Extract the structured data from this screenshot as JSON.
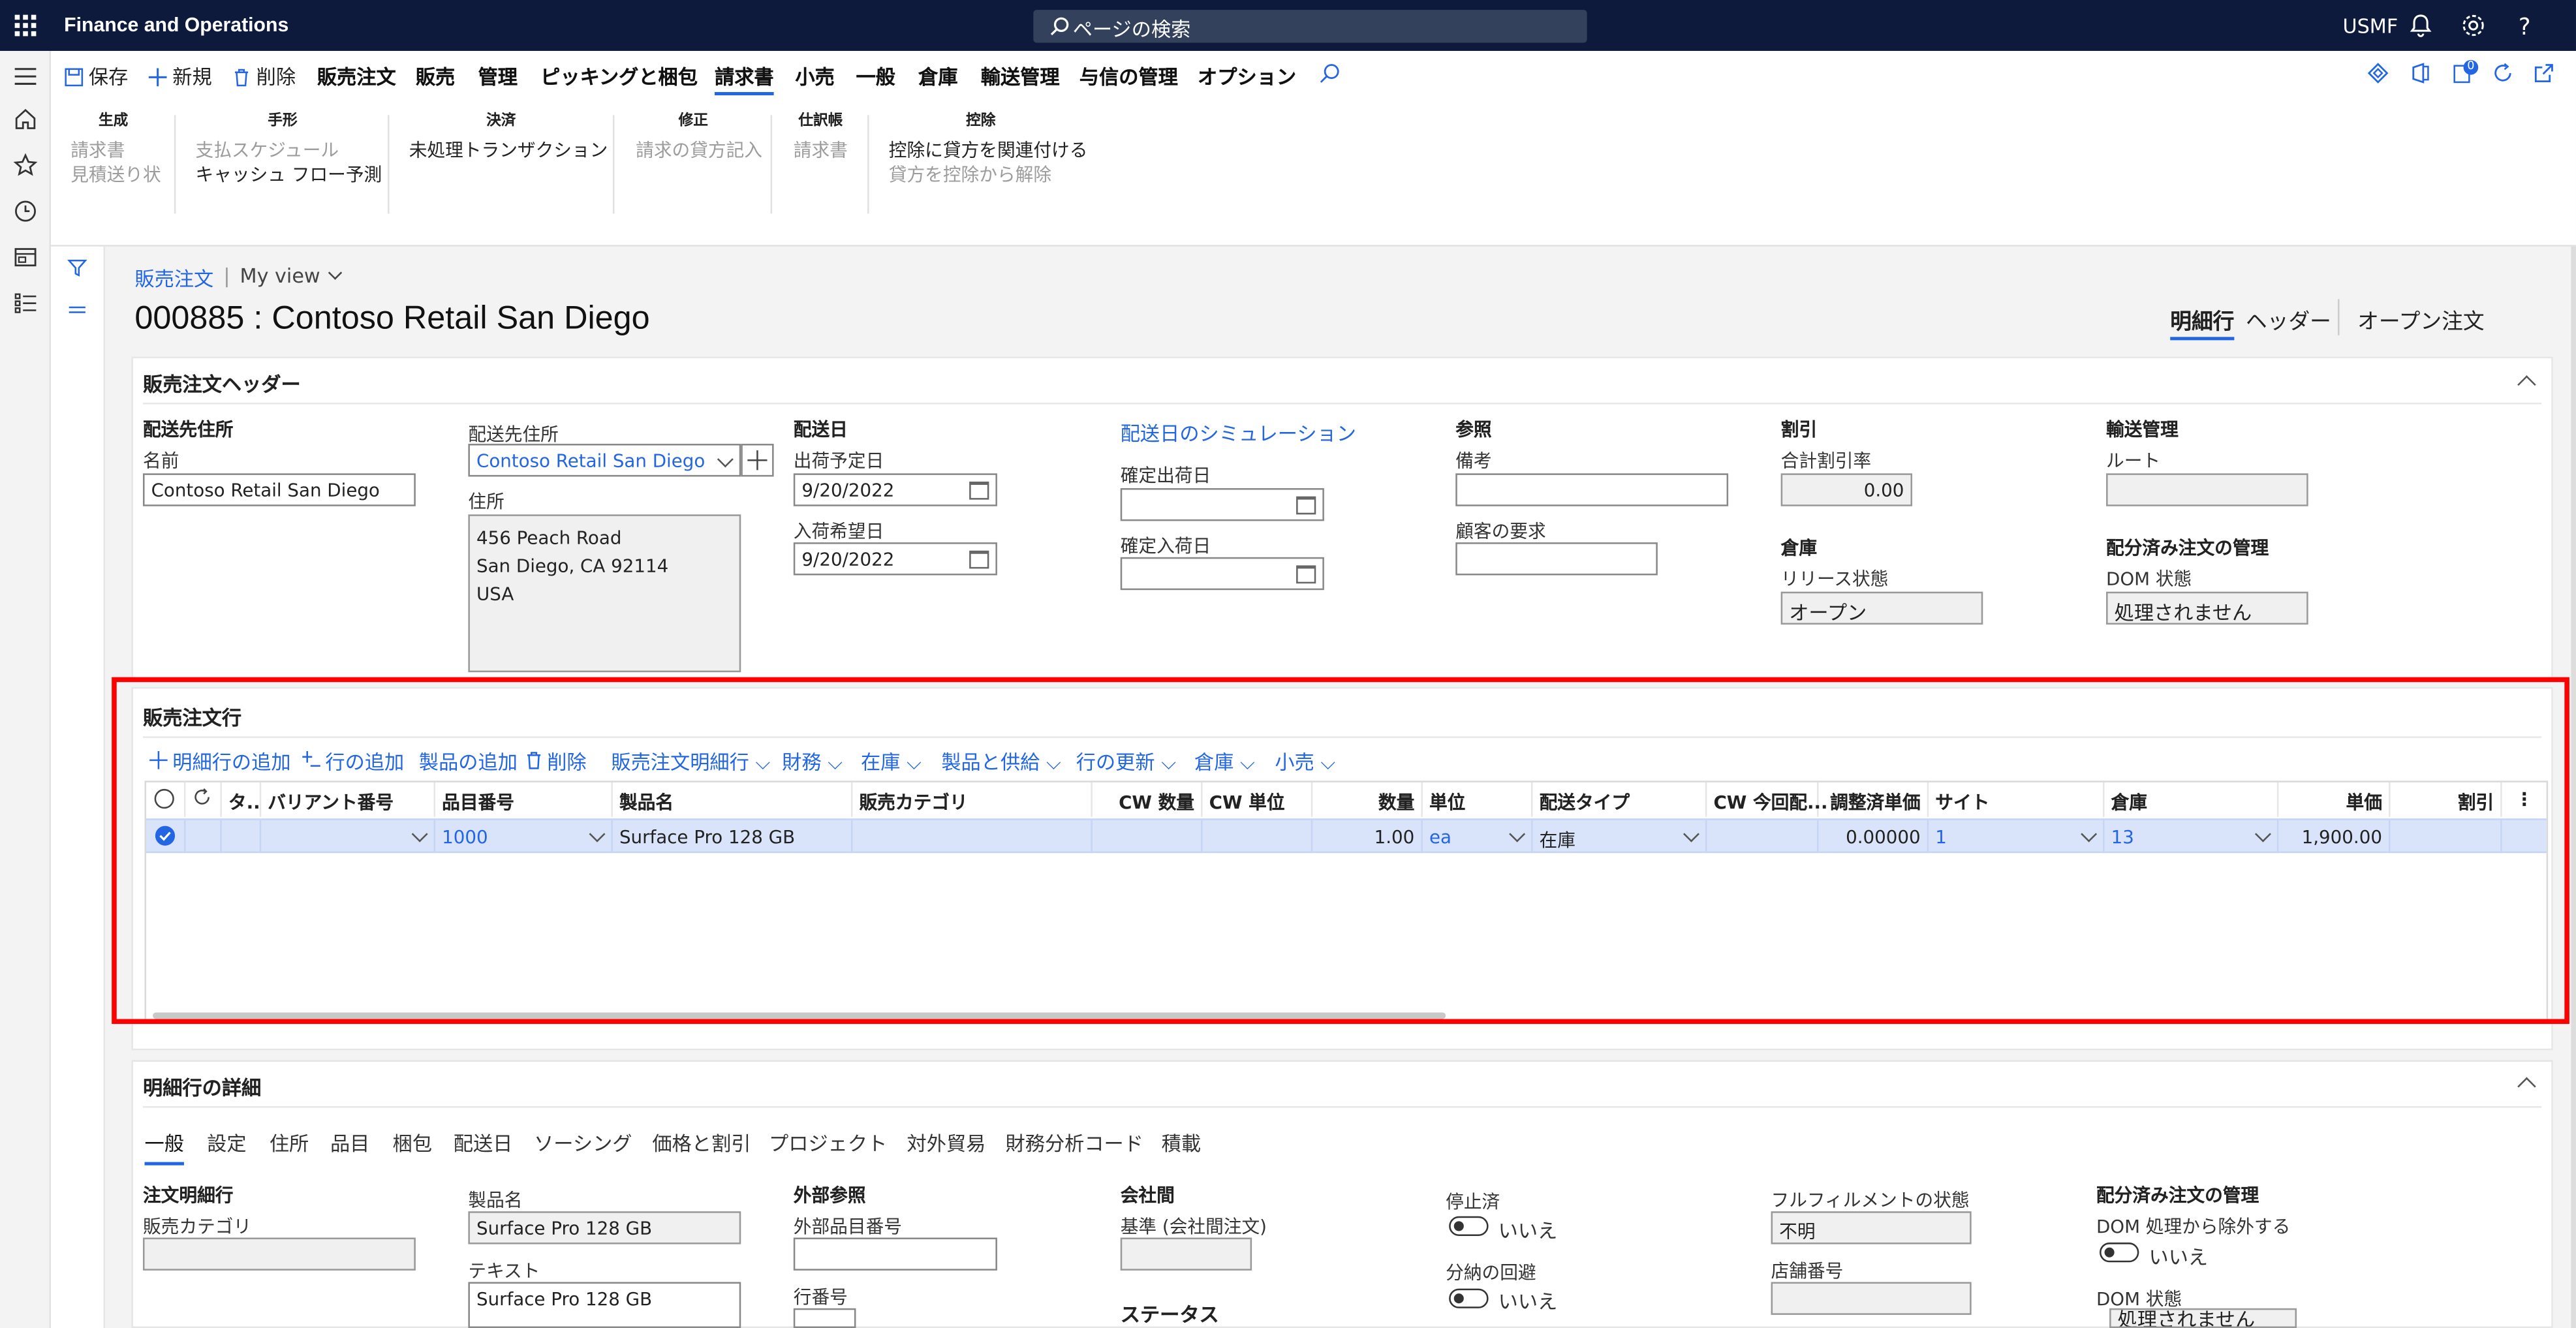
{
  "app_title": "Finance and Operations",
  "search": {
    "placeholder": "ページの検索"
  },
  "company": "USMF",
  "notification_count": "0",
  "action_pane": {
    "buttons": {
      "save": "保存",
      "new": "新規",
      "delete": "削除"
    },
    "tabs": [
      "販売注文",
      "販売",
      "管理",
      "ピッキングと梱包",
      "請求書",
      "小売",
      "一般",
      "倉庫",
      "輸送管理",
      "与信の管理",
      "オプション"
    ],
    "active_tab": "請求書",
    "groups": {
      "generate": {
        "title": "生成",
        "items": [
          "請求書",
          "見積送り状"
        ]
      },
      "draft": {
        "title": "手形",
        "items": [
          "支払スケジュール",
          "キャッシュ フロー予測"
        ]
      },
      "settle": {
        "title": "決済",
        "items": [
          "未処理トランザクション"
        ]
      },
      "correct": {
        "title": "修正",
        "items": [
          "請求の貸方記入"
        ]
      },
      "journal": {
        "title": "仕訳帳",
        "items": [
          "請求書"
        ]
      },
      "deduction": {
        "title": "控除",
        "items": [
          "控除に貸方を関連付ける",
          "貸方を控除から解除"
        ]
      }
    }
  },
  "breadcrumb": {
    "link": "販売注文",
    "separator": "|",
    "view": "My view"
  },
  "page_title": "000885 : Contoso Retail San Diego",
  "view_tabs": {
    "lines": "明細行",
    "header": "ヘッダー",
    "open_orders": "オープン注文"
  },
  "header_section": {
    "title": "販売注文ヘッダー",
    "delivery_address_group": "配送先住所",
    "name_label": "名前",
    "name_value": "Contoso Retail San Diego",
    "delivery_address_label": "配送先住所",
    "delivery_address_value": "Contoso Retail San Diego",
    "address_label": "住所",
    "address_lines": [
      "456 Peach Road",
      "San Diego, CA 92114",
      "USA"
    ],
    "delivery_date_group": "配送日",
    "ship_date_label": "出荷予定日",
    "ship_date_value": "9/20/2022",
    "receipt_date_label": "入荷希望日",
    "receipt_date_value": "9/20/2022",
    "simulation_link": "配送日のシミュレーション",
    "confirmed_ship_label": "確定出荷日",
    "confirmed_receipt_label": "確定入荷日",
    "reference_group": "参照",
    "remarks_label": "備考",
    "customer_req_label": "顧客の要求",
    "discount_group": "割引",
    "total_discount_label": "合計割引率",
    "total_discount_value": "0.00",
    "warehouse_group": "倉庫",
    "release_status_label": "リリース状態",
    "release_status_value": "オープン",
    "transport_group": "輸送管理",
    "route_label": "ルート",
    "dom_group": "配分済み注文の管理",
    "dom_status_label": "DOM 状態",
    "dom_status_value": "処理されません"
  },
  "lines_section": {
    "title": "販売注文行",
    "toolbar": [
      "明細行の追加",
      "行の追加",
      "製品の追加",
      "削除",
      "販売注文明細行",
      "財務",
      "在庫",
      "製品と供給",
      "行の更新",
      "倉庫",
      "小売"
    ],
    "columns": [
      "タ..",
      "バリアント番号",
      "品目番号",
      "製品名",
      "販売カテゴリ",
      "CW 数量",
      "CW 単位",
      "数量",
      "単位",
      "配送タイプ",
      "CW 今回配...",
      "調整済単価",
      "サイト",
      "倉庫",
      "単価",
      "割引"
    ],
    "rows": [
      {
        "variant": "",
        "item": "1000",
        "product": "Surface Pro 128 GB",
        "category": "",
        "cw_qty": "",
        "cw_unit": "",
        "qty": "1.00",
        "unit": "ea",
        "delivery_type": "在庫",
        "cw_deliver": "",
        "adj_price": "0.00000",
        "site": "1",
        "warehouse": "13",
        "price": "1,900.00",
        "discount": ""
      }
    ]
  },
  "details_section": {
    "title": "明細行の詳細",
    "tabs": [
      "一般",
      "設定",
      "住所",
      "品目",
      "梱包",
      "配送日",
      "ソーシング",
      "価格と割引",
      "プロジェクト",
      "対外貿易",
      "財務分析コード",
      "積載"
    ],
    "active_tab": "一般",
    "order_line_group": "注文明細行",
    "sales_category_label": "販売カテゴリ",
    "product_name_label": "製品名",
    "product_name_value": "Surface Pro 128 GB",
    "text_label": "テキスト",
    "text_value": "Surface Pro 128 GB",
    "external_ref_group": "外部参照",
    "external_item_label": "外部品目番号",
    "line_no_label": "行番号",
    "intercompany_group": "会社間",
    "intercompany_basis_label": "基準 (会社間注文)",
    "status_group": "ステータス",
    "stopped_label": "停止済",
    "stopped_value": "いいえ",
    "avoid_split_label": "分納の回避",
    "avoid_split_value": "いいえ",
    "fulfillment_label": "フルフィルメントの状態",
    "fulfillment_value": "不明",
    "store_number_label": "店舗番号",
    "dom_group": "配分済み注文の管理",
    "dom_exclude_label": "DOM 処理から除外する",
    "dom_exclude_value": "いいえ",
    "dom_status_label": "DOM 状態",
    "dom_status_value": "処理されません"
  }
}
